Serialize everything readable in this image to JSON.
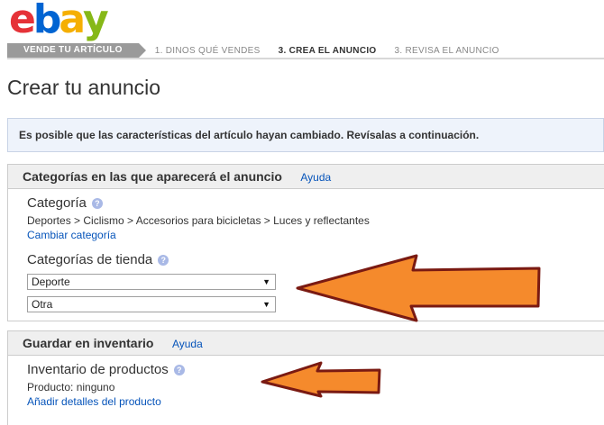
{
  "logo": {
    "letters": [
      "e",
      "b",
      "a",
      "y"
    ]
  },
  "steps": {
    "active": "VENDE TU ARTÍCULO",
    "items": [
      "1. DINOS QUÉ VENDES",
      "3. CREA EL ANUNCIO",
      "3. REVISA EL ANUNCIO"
    ]
  },
  "page": {
    "title": "Crear tu anuncio"
  },
  "notice": {
    "text": "Es posible que las características del artículo hayan cambiado. Revísalas a continuación."
  },
  "categories_panel": {
    "title": "Categorías en las que aparecerá el anuncio",
    "help": "Ayuda",
    "category_label": "Categoría",
    "category_path": "Deportes > Ciclismo > Accesorios para bicicletas > Luces y reflectantes",
    "change_link": "Cambiar categoría",
    "store_label": "Categorías de tienda",
    "store_select_1": "Deporte",
    "store_select_2": "Otra"
  },
  "inventory_panel": {
    "title": "Guardar en inventario",
    "help": "Ayuda",
    "product_label": "Inventario de productos",
    "product_value": "Producto: ninguno",
    "add_link": "Añadir detalles del producto"
  },
  "icons": {
    "help": "?",
    "caret": "▼"
  },
  "colors": {
    "arrow_fill": "#f58a2c",
    "arrow_stroke": "#7a1a12",
    "link": "#0654ba"
  }
}
